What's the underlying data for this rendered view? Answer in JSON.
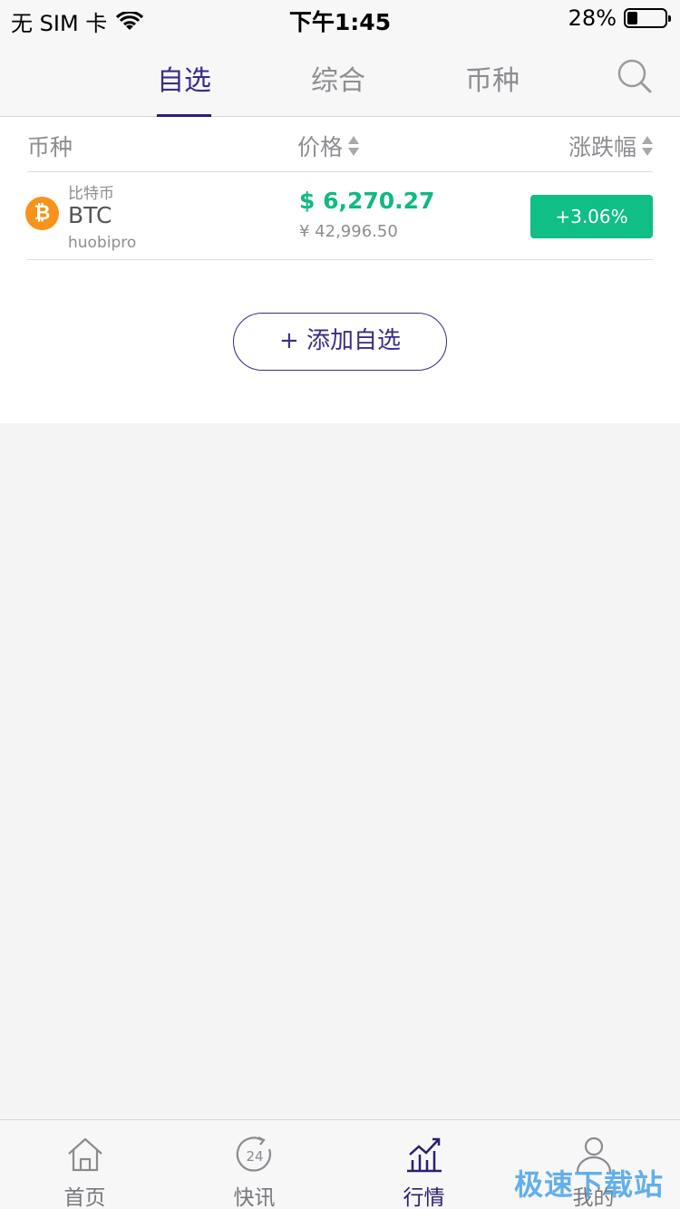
{
  "status_bar": {
    "carrier": "无 SIM 卡",
    "time": "下午1:45",
    "battery_percent": "28%",
    "battery_level": 0.28
  },
  "tabs": [
    {
      "label": "自选",
      "active": true
    },
    {
      "label": "综合",
      "active": false
    },
    {
      "label": "币种",
      "active": false
    }
  ],
  "list": {
    "headers": {
      "coin": "币种",
      "price": "价格",
      "change": "涨跌幅"
    },
    "rows": [
      {
        "name_cn": "比特币",
        "symbol": "BTC",
        "exchange": "huobipro",
        "icon_glyph": "₿",
        "price_usd": "$ 6,270.27",
        "price_cny": "¥ 42,996.50",
        "change": "+3.06%"
      }
    ],
    "add_button": "+ 添加自选"
  },
  "bottom_nav": [
    {
      "label": "首页",
      "icon": "home-icon",
      "active": false
    },
    {
      "label": "快讯",
      "icon": "news-24-icon",
      "badge": "24",
      "active": false
    },
    {
      "label": "行情",
      "icon": "market-chart-icon",
      "active": true
    },
    {
      "label": "我的",
      "icon": "user-icon",
      "active": false
    }
  ],
  "watermark": "极速下载站",
  "colors": {
    "accent": "#3d2b86",
    "up_green": "#0fbf85",
    "bitcoin_orange": "#f7931a"
  }
}
